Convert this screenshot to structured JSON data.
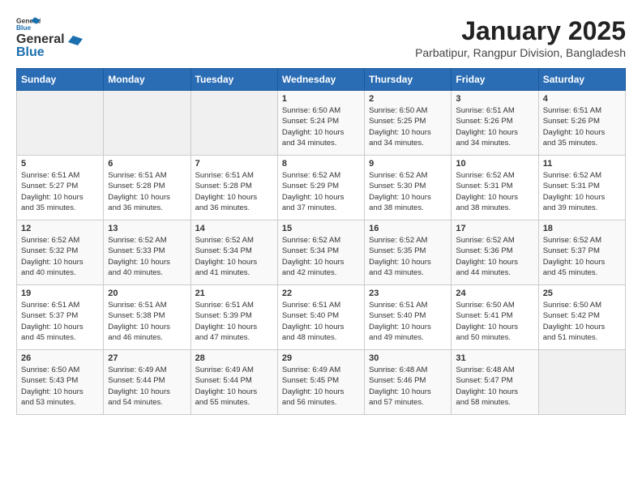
{
  "header": {
    "logo_line1": "General",
    "logo_line2": "Blue",
    "month": "January 2025",
    "location": "Parbatipur, Rangpur Division, Bangladesh"
  },
  "days_of_week": [
    "Sunday",
    "Monday",
    "Tuesday",
    "Wednesday",
    "Thursday",
    "Friday",
    "Saturday"
  ],
  "weeks": [
    [
      {
        "day": "",
        "content": ""
      },
      {
        "day": "",
        "content": ""
      },
      {
        "day": "",
        "content": ""
      },
      {
        "day": "1",
        "content": "Sunrise: 6:50 AM\nSunset: 5:24 PM\nDaylight: 10 hours\nand 34 minutes."
      },
      {
        "day": "2",
        "content": "Sunrise: 6:50 AM\nSunset: 5:25 PM\nDaylight: 10 hours\nand 34 minutes."
      },
      {
        "day": "3",
        "content": "Sunrise: 6:51 AM\nSunset: 5:26 PM\nDaylight: 10 hours\nand 34 minutes."
      },
      {
        "day": "4",
        "content": "Sunrise: 6:51 AM\nSunset: 5:26 PM\nDaylight: 10 hours\nand 35 minutes."
      }
    ],
    [
      {
        "day": "5",
        "content": "Sunrise: 6:51 AM\nSunset: 5:27 PM\nDaylight: 10 hours\nand 35 minutes."
      },
      {
        "day": "6",
        "content": "Sunrise: 6:51 AM\nSunset: 5:28 PM\nDaylight: 10 hours\nand 36 minutes."
      },
      {
        "day": "7",
        "content": "Sunrise: 6:51 AM\nSunset: 5:28 PM\nDaylight: 10 hours\nand 36 minutes."
      },
      {
        "day": "8",
        "content": "Sunrise: 6:52 AM\nSunset: 5:29 PM\nDaylight: 10 hours\nand 37 minutes."
      },
      {
        "day": "9",
        "content": "Sunrise: 6:52 AM\nSunset: 5:30 PM\nDaylight: 10 hours\nand 38 minutes."
      },
      {
        "day": "10",
        "content": "Sunrise: 6:52 AM\nSunset: 5:31 PM\nDaylight: 10 hours\nand 38 minutes."
      },
      {
        "day": "11",
        "content": "Sunrise: 6:52 AM\nSunset: 5:31 PM\nDaylight: 10 hours\nand 39 minutes."
      }
    ],
    [
      {
        "day": "12",
        "content": "Sunrise: 6:52 AM\nSunset: 5:32 PM\nDaylight: 10 hours\nand 40 minutes."
      },
      {
        "day": "13",
        "content": "Sunrise: 6:52 AM\nSunset: 5:33 PM\nDaylight: 10 hours\nand 40 minutes."
      },
      {
        "day": "14",
        "content": "Sunrise: 6:52 AM\nSunset: 5:34 PM\nDaylight: 10 hours\nand 41 minutes."
      },
      {
        "day": "15",
        "content": "Sunrise: 6:52 AM\nSunset: 5:34 PM\nDaylight: 10 hours\nand 42 minutes."
      },
      {
        "day": "16",
        "content": "Sunrise: 6:52 AM\nSunset: 5:35 PM\nDaylight: 10 hours\nand 43 minutes."
      },
      {
        "day": "17",
        "content": "Sunrise: 6:52 AM\nSunset: 5:36 PM\nDaylight: 10 hours\nand 44 minutes."
      },
      {
        "day": "18",
        "content": "Sunrise: 6:52 AM\nSunset: 5:37 PM\nDaylight: 10 hours\nand 45 minutes."
      }
    ],
    [
      {
        "day": "19",
        "content": "Sunrise: 6:51 AM\nSunset: 5:37 PM\nDaylight: 10 hours\nand 45 minutes."
      },
      {
        "day": "20",
        "content": "Sunrise: 6:51 AM\nSunset: 5:38 PM\nDaylight: 10 hours\nand 46 minutes."
      },
      {
        "day": "21",
        "content": "Sunrise: 6:51 AM\nSunset: 5:39 PM\nDaylight: 10 hours\nand 47 minutes."
      },
      {
        "day": "22",
        "content": "Sunrise: 6:51 AM\nSunset: 5:40 PM\nDaylight: 10 hours\nand 48 minutes."
      },
      {
        "day": "23",
        "content": "Sunrise: 6:51 AM\nSunset: 5:40 PM\nDaylight: 10 hours\nand 49 minutes."
      },
      {
        "day": "24",
        "content": "Sunrise: 6:50 AM\nSunset: 5:41 PM\nDaylight: 10 hours\nand 50 minutes."
      },
      {
        "day": "25",
        "content": "Sunrise: 6:50 AM\nSunset: 5:42 PM\nDaylight: 10 hours\nand 51 minutes."
      }
    ],
    [
      {
        "day": "26",
        "content": "Sunrise: 6:50 AM\nSunset: 5:43 PM\nDaylight: 10 hours\nand 53 minutes."
      },
      {
        "day": "27",
        "content": "Sunrise: 6:49 AM\nSunset: 5:44 PM\nDaylight: 10 hours\nand 54 minutes."
      },
      {
        "day": "28",
        "content": "Sunrise: 6:49 AM\nSunset: 5:44 PM\nDaylight: 10 hours\nand 55 minutes."
      },
      {
        "day": "29",
        "content": "Sunrise: 6:49 AM\nSunset: 5:45 PM\nDaylight: 10 hours\nand 56 minutes."
      },
      {
        "day": "30",
        "content": "Sunrise: 6:48 AM\nSunset: 5:46 PM\nDaylight: 10 hours\nand 57 minutes."
      },
      {
        "day": "31",
        "content": "Sunrise: 6:48 AM\nSunset: 5:47 PM\nDaylight: 10 hours\nand 58 minutes."
      },
      {
        "day": "",
        "content": ""
      }
    ]
  ]
}
